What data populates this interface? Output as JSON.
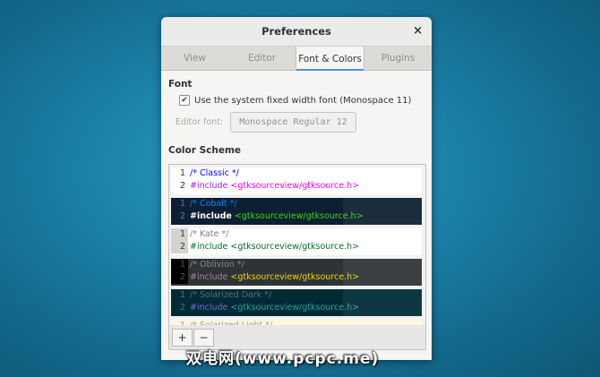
{
  "dialog": {
    "title": "Preferences",
    "close_glyph": "×"
  },
  "tabs": [
    {
      "label": "View"
    },
    {
      "label": "Editor"
    },
    {
      "label": "Font & Colors"
    },
    {
      "label": "Plugins"
    }
  ],
  "font_section": {
    "label": "Font",
    "use_system_font": "Use the system fixed width font (Monospace 11)",
    "checked": true,
    "editor_font_label": "Editor font:",
    "editor_font_value": "Monospace Regular  12"
  },
  "color_scheme": {
    "label": "Color Scheme",
    "schemes": [
      {
        "comment": "/* Classic */",
        "include_kw": "#include",
        "include_path": " <gtksourceview/gtksource.h>",
        "bg": "#ffffff",
        "gutter": "#ffffff",
        "ln": "#2e3436",
        "comment_color": "#0000ff",
        "kw_color": "#a020f0",
        "path_color": "#ff00ff"
      },
      {
        "comment": "/* Cobalt */",
        "include_kw": "#include",
        "include_path": " <gtksourceview/gtksource.h>",
        "bg": "#0d1f33",
        "gutter": "#0d1f33",
        "ln": "#4f7fa3",
        "comment_color": "#0088ff",
        "kw_color": "#ffffff",
        "path_color": "#3ad900"
      },
      {
        "comment": "/* Kate */",
        "include_kw": "#include",
        "include_path": " <gtksourceview/gtksource.h>",
        "bg": "#ffffff",
        "gutter": "#d6d2d0",
        "ln": "#2e3436",
        "comment_color": "#808080",
        "kw_color": "#006e28",
        "path_color": "#006e28"
      },
      {
        "comment": "/* Oblivion */",
        "include_kw": "#include",
        "include_path": " <gtksourceview/gtksource.h>",
        "bg": "#2e3436",
        "gutter": "#000000",
        "ln": "#555753",
        "comment_color": "#888a85",
        "kw_color": "#ad7fa8",
        "path_color": "#edd400"
      },
      {
        "comment": "/* Solarized Dark */",
        "include_kw": "#include",
        "include_path": " <gtksourceview/gtksource.h>",
        "bg": "#002b36",
        "gutter": "#002b36",
        "ln": "#586e75",
        "comment_color": "#586e75",
        "kw_color": "#6c71c4",
        "path_color": "#2aa198"
      },
      {
        "comment": "/* Solarized Light */",
        "include_kw": "",
        "include_path": "",
        "bg": "#fdf6e3",
        "gutter": "#fdf6e3",
        "ln": "#93a1a1",
        "comment_color": "#93a1a1",
        "kw_color": "#6c71c4",
        "path_color": "#2aa198"
      }
    ]
  },
  "toolbar": {
    "add_label": "+",
    "remove_label": "−"
  },
  "watermark": "双电网(www.pcpc.me)"
}
